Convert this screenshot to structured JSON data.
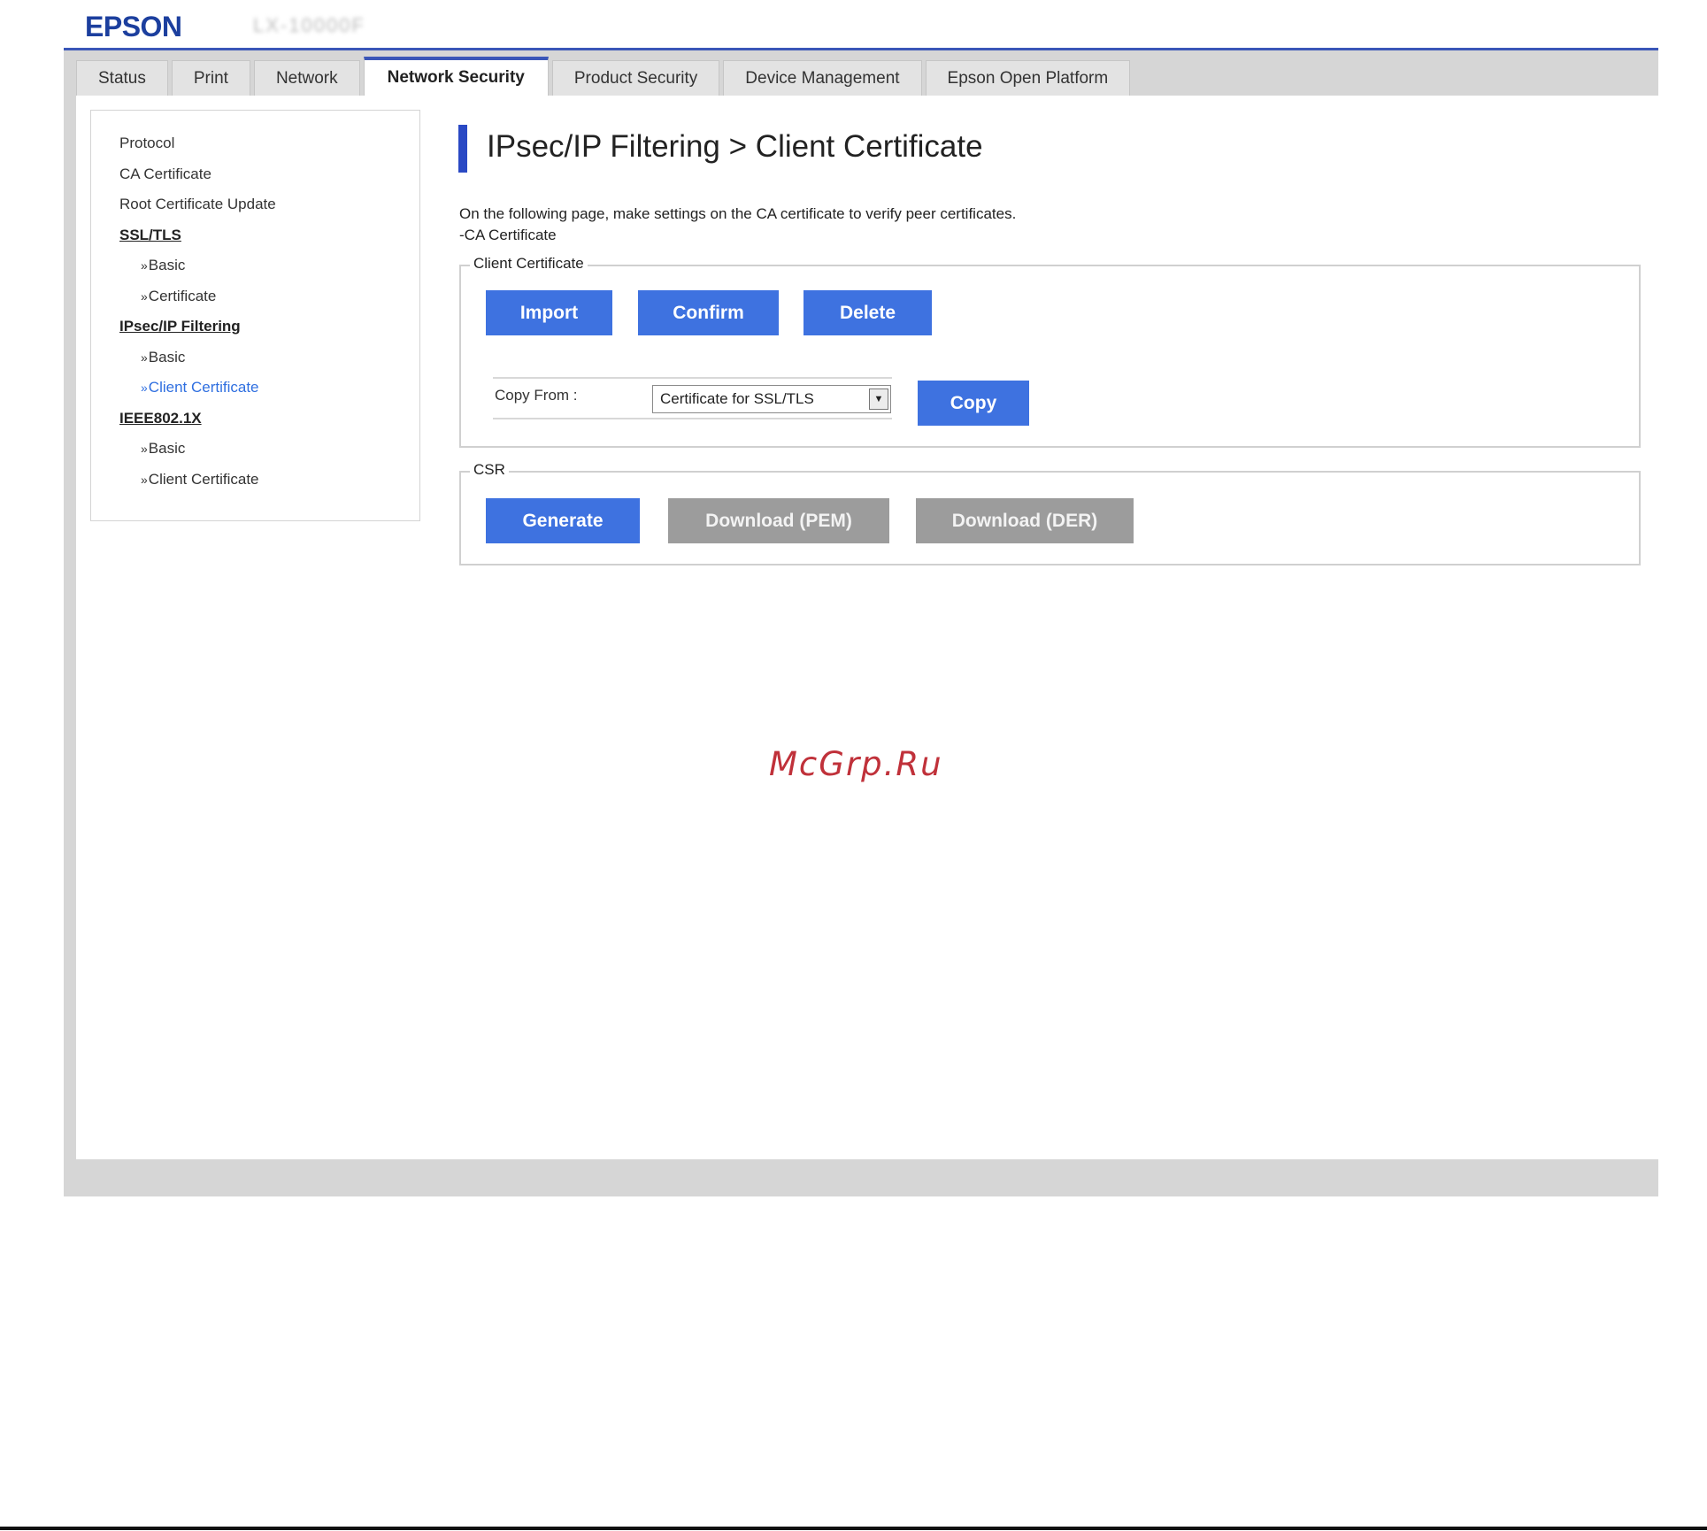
{
  "header": {
    "brand": "EPSON",
    "model": "LX-10000F"
  },
  "tabs": [
    {
      "label": "Status",
      "active": false
    },
    {
      "label": "Print",
      "active": false
    },
    {
      "label": "Network",
      "active": false
    },
    {
      "label": "Network Security",
      "active": true
    },
    {
      "label": "Product Security",
      "active": false
    },
    {
      "label": "Device Management",
      "active": false
    },
    {
      "label": "Epson Open Platform",
      "active": false
    }
  ],
  "sidebar": {
    "items": [
      {
        "label": "Protocol"
      },
      {
        "label": "CA Certificate"
      },
      {
        "label": "Root Certificate Update"
      },
      {
        "label": "SSL/TLS"
      },
      {
        "label": "Basic"
      },
      {
        "label": "Certificate"
      },
      {
        "label": "IPsec/IP Filtering"
      },
      {
        "label": "Basic"
      },
      {
        "label": "Client Certificate"
      },
      {
        "label": "IEEE802.1X"
      },
      {
        "label": "Basic"
      },
      {
        "label": "Client Certificate"
      }
    ]
  },
  "main": {
    "title": "IPsec/IP Filtering > Client Certificate",
    "description_line1": "On the following page, make settings on the CA certificate to verify peer certificates.",
    "description_line2": "-CA Certificate",
    "client_certificate": {
      "legend": "Client Certificate",
      "import_label": "Import",
      "confirm_label": "Confirm",
      "delete_label": "Delete",
      "copy_from_label": "Copy From :",
      "copy_from_value": "Certificate for SSL/TLS",
      "copy_label": "Copy"
    },
    "csr": {
      "legend": "CSR",
      "generate_label": "Generate",
      "download_pem_label": "Download (PEM)",
      "download_der_label": "Download (DER)"
    }
  },
  "watermark": "McGrp.Ru",
  "colors": {
    "brand_blue": "#1c3f9e",
    "accent": "#3a56b8",
    "button_blue": "#3e72e0",
    "button_disabled": "#9c9c9c",
    "link_current": "#2f6fe0"
  }
}
